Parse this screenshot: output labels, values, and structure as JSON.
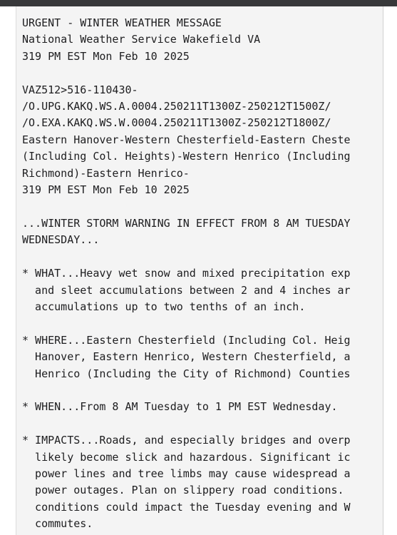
{
  "window": {
    "chrome_bar_color": "#37383a",
    "page_background": "#ffffff",
    "panel_background": "#f4f4f4",
    "panel_border_color": "#d8d8d8",
    "text_color": "#1d1d1f"
  },
  "bulletin": {
    "headline_title": "URGENT - WINTER WEATHER MESSAGE",
    "issuing_office": "National Weather Service Wakefield VA",
    "issue_time": "319 PM EST Mon Feb 10 2025",
    "ugc_line": "VAZ512>516-110430-",
    "vtec_lines": [
      "/O.UPG.KAKQ.WS.A.0004.250211T1300Z-250212T1500Z/",
      "/O.EXA.KAKQ.WS.W.0004.250211T1300Z-250212T1800Z/"
    ],
    "zone_names": [
      "Eastern Hanover-Western Chesterfield-Eastern Cheste",
      "(Including Col. Heights)-Western Henrico (Including",
      "Richmond)-Eastern Henrico-"
    ],
    "product_time": "319 PM EST Mon Feb 10 2025",
    "warning_headline": [
      "...WINTER STORM WARNING IN EFFECT FROM 8 AM TUESDAY",
      "WEDNESDAY..."
    ],
    "sections": [
      {
        "label": "WHAT",
        "lines": [
          "* WHAT...Heavy wet snow and mixed precipitation exp",
          "  and sleet accumulations between 2 and 4 inches ar",
          "  accumulations up to two tenths of an inch."
        ]
      },
      {
        "label": "WHERE",
        "lines": [
          "* WHERE...Eastern Chesterfield (Including Col. Heig",
          "  Hanover, Eastern Henrico, Western Chesterfield, a",
          "  Henrico (Including the City of Richmond) Counties"
        ]
      },
      {
        "label": "WHEN",
        "lines": [
          "* WHEN...From 8 AM Tuesday to 1 PM EST Wednesday."
        ]
      },
      {
        "label": "IMPACTS",
        "lines": [
          "* IMPACTS...Roads, and especially bridges and overp",
          "  likely become slick and hazardous. Significant ic",
          "  power lines and tree limbs may cause widespread a",
          "  power outages. Plan on slippery road conditions.",
          "  conditions could impact the Tuesday evening and W",
          "  commutes."
        ]
      }
    ],
    "full_text": "URGENT - WINTER WEATHER MESSAGE\nNational Weather Service Wakefield VA\n319 PM EST Mon Feb 10 2025\n\nVAZ512>516-110430-\n/O.UPG.KAKQ.WS.A.0004.250211T1300Z-250212T1500Z/\n/O.EXA.KAKQ.WS.W.0004.250211T1300Z-250212T1800Z/\nEastern Hanover-Western Chesterfield-Eastern Cheste\n(Including Col. Heights)-Western Henrico (Including\nRichmond)-Eastern Henrico-\n319 PM EST Mon Feb 10 2025\n\n...WINTER STORM WARNING IN EFFECT FROM 8 AM TUESDAY\nWEDNESDAY...\n\n* WHAT...Heavy wet snow and mixed precipitation exp\n  and sleet accumulations between 2 and 4 inches ar\n  accumulations up to two tenths of an inch.\n\n* WHERE...Eastern Chesterfield (Including Col. Heig\n  Hanover, Eastern Henrico, Western Chesterfield, a\n  Henrico (Including the City of Richmond) Counties\n\n* WHEN...From 8 AM Tuesday to 1 PM EST Wednesday.\n\n* IMPACTS...Roads, and especially bridges and overp\n  likely become slick and hazardous. Significant ic\n  power lines and tree limbs may cause widespread a\n  power outages. Plan on slippery road conditions.\n  conditions could impact the Tuesday evening and W\n  commutes."
  }
}
